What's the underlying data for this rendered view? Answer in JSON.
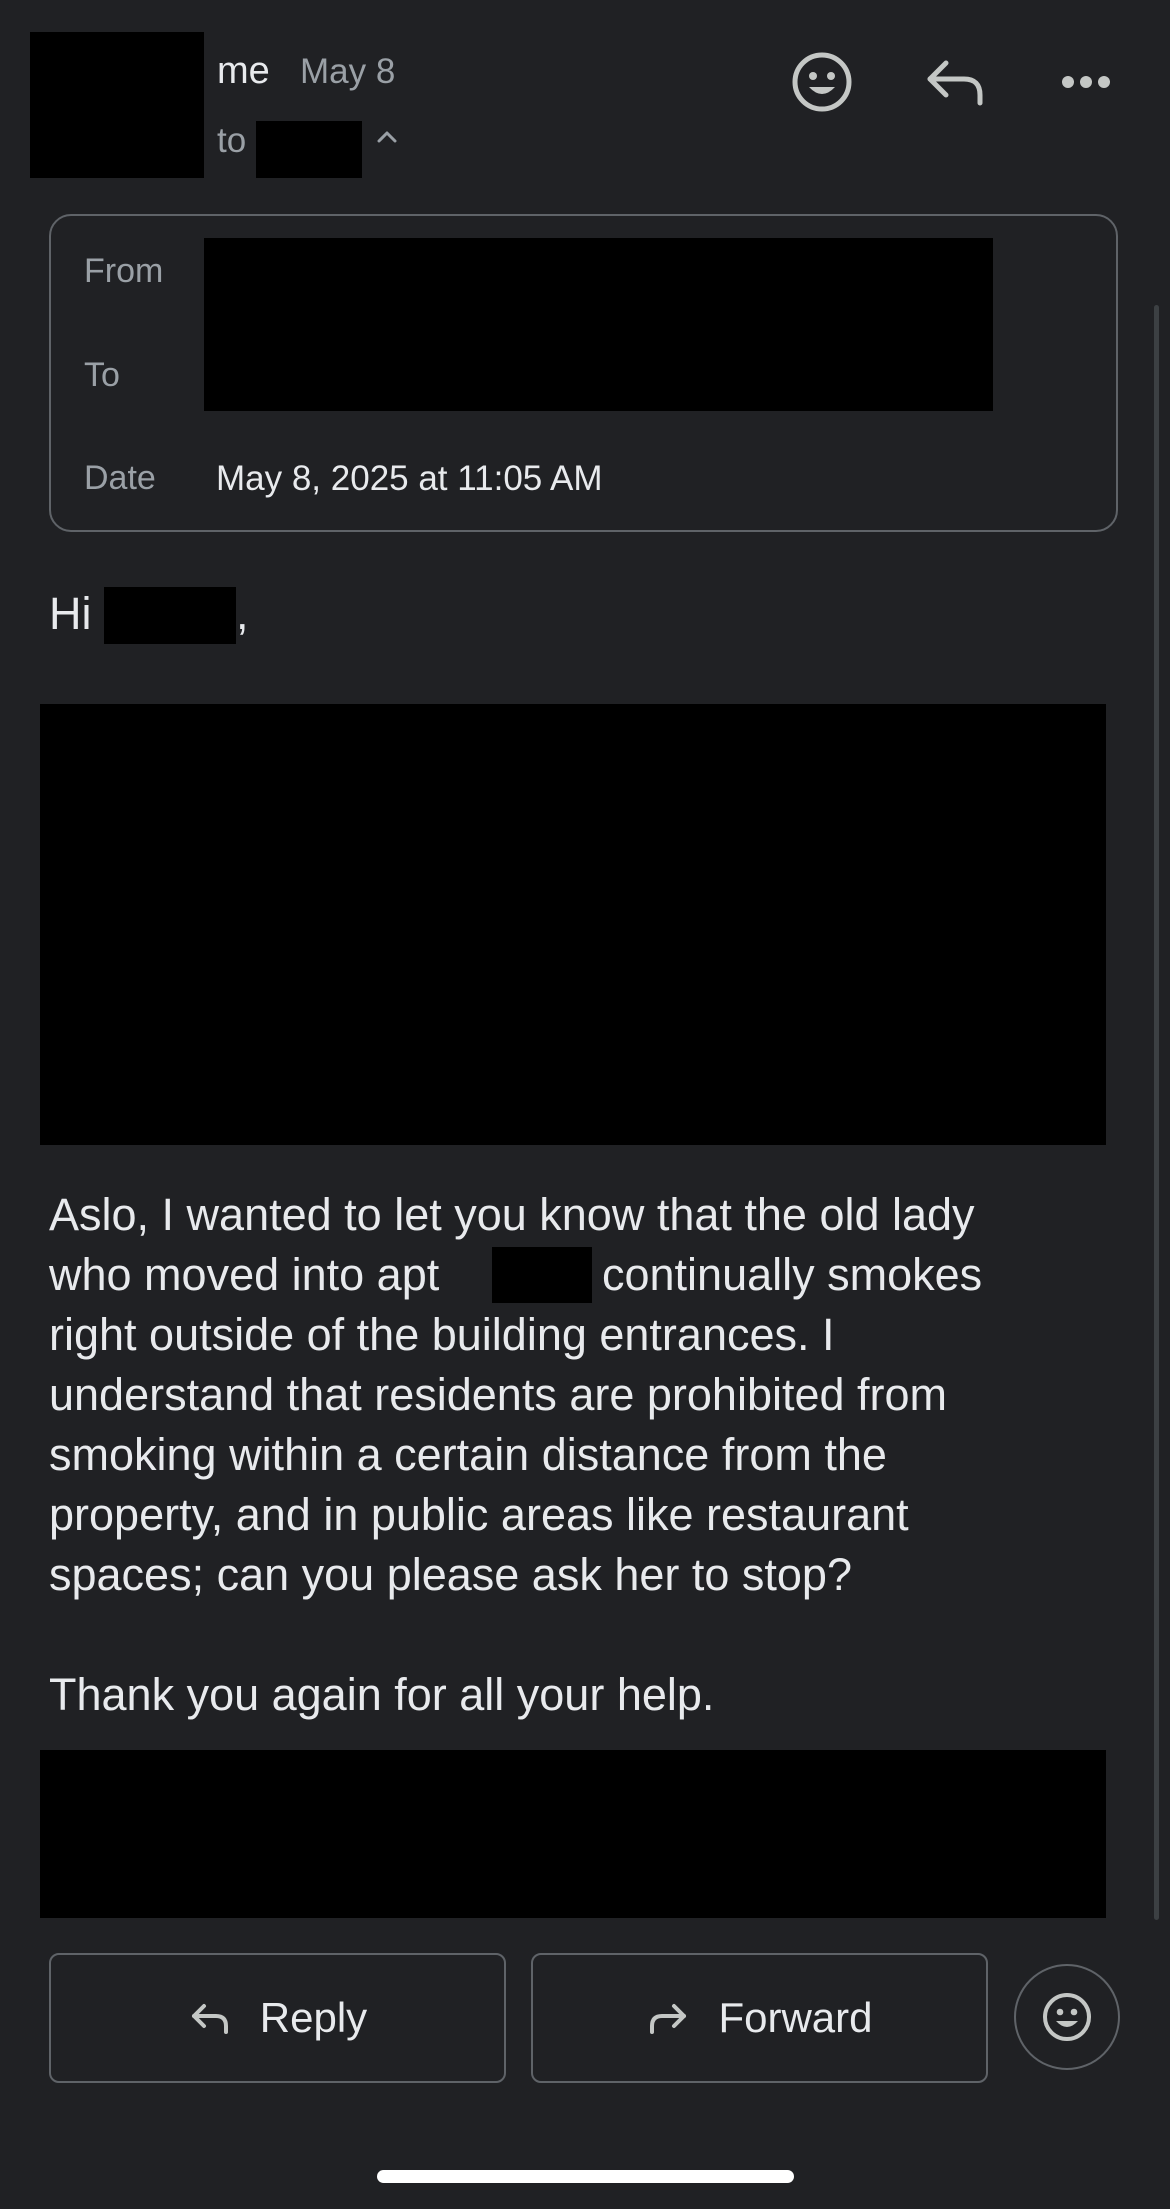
{
  "header": {
    "sender": "me",
    "date": "May 8",
    "to_label": "to"
  },
  "details": {
    "from_label": "From",
    "to_label": "To",
    "date_label": "Date",
    "date_value": "May 8, 2025 at 11:05 AM"
  },
  "body": {
    "greeting_hi": "Hi",
    "greeting_comma": ",",
    "para_line1": "Aslo, I wanted to let you know that the old lady",
    "para_line2a": "who moved into apt",
    "para_line2b": "continually smokes",
    "para_line3": "right outside of the building entrances. I",
    "para_line4": "understand that residents are prohibited from",
    "para_line5": "smoking within a certain distance from the",
    "para_line6": "property, and in public areas like restaurant",
    "para_line7": "spaces; can you please ask her to stop?",
    "thanks": "Thank you again for all your help."
  },
  "actions": {
    "reply_label": "Reply",
    "forward_label": "Forward"
  },
  "icons": {
    "emoji": "smiley-icon",
    "reply": "reply-arrow-icon",
    "more": "more-horizontal-icon",
    "chevron": "chevron-up-icon",
    "forward": "forward-arrow-icon"
  },
  "colors": {
    "background": "#202124",
    "text": "#e8eaed",
    "muted": "#9aa0a6",
    "border": "#5f6368",
    "redaction": "#000000"
  }
}
